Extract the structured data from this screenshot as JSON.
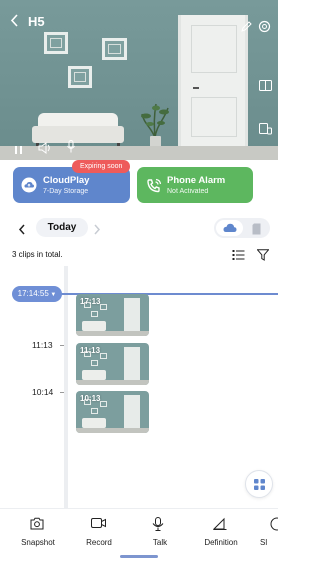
{
  "header": {
    "title": "H5"
  },
  "cards": {
    "cloudplay": {
      "title": "CloudPlay",
      "subtitle": "7-Day Storage",
      "badge": "Expiring soon",
      "color": "#5f86cc"
    },
    "phone_alarm": {
      "title": "Phone Alarm",
      "subtitle": "Not Activated",
      "color": "#5db75f"
    }
  },
  "date_nav": {
    "label": "Today"
  },
  "clips": {
    "count_text": "3 clips in total.",
    "current_time": "17:14:55",
    "time_labels": [
      "11:13",
      "10:14"
    ],
    "items": [
      {
        "label": "17:13"
      },
      {
        "label": "11:13"
      },
      {
        "label": "10:13"
      }
    ]
  },
  "toolbar": {
    "items": [
      {
        "label": "Snapshot",
        "icon": "camera-icon"
      },
      {
        "label": "Record",
        "icon": "video-record-icon"
      },
      {
        "label": "Talk",
        "icon": "microphone-icon"
      },
      {
        "label": "Definition",
        "icon": "definition-icon"
      },
      {
        "label": "Sl",
        "icon": "partial-icon"
      }
    ]
  },
  "colors": {
    "accent": "#6f8fd6",
    "alert": "#ee5b5b"
  }
}
